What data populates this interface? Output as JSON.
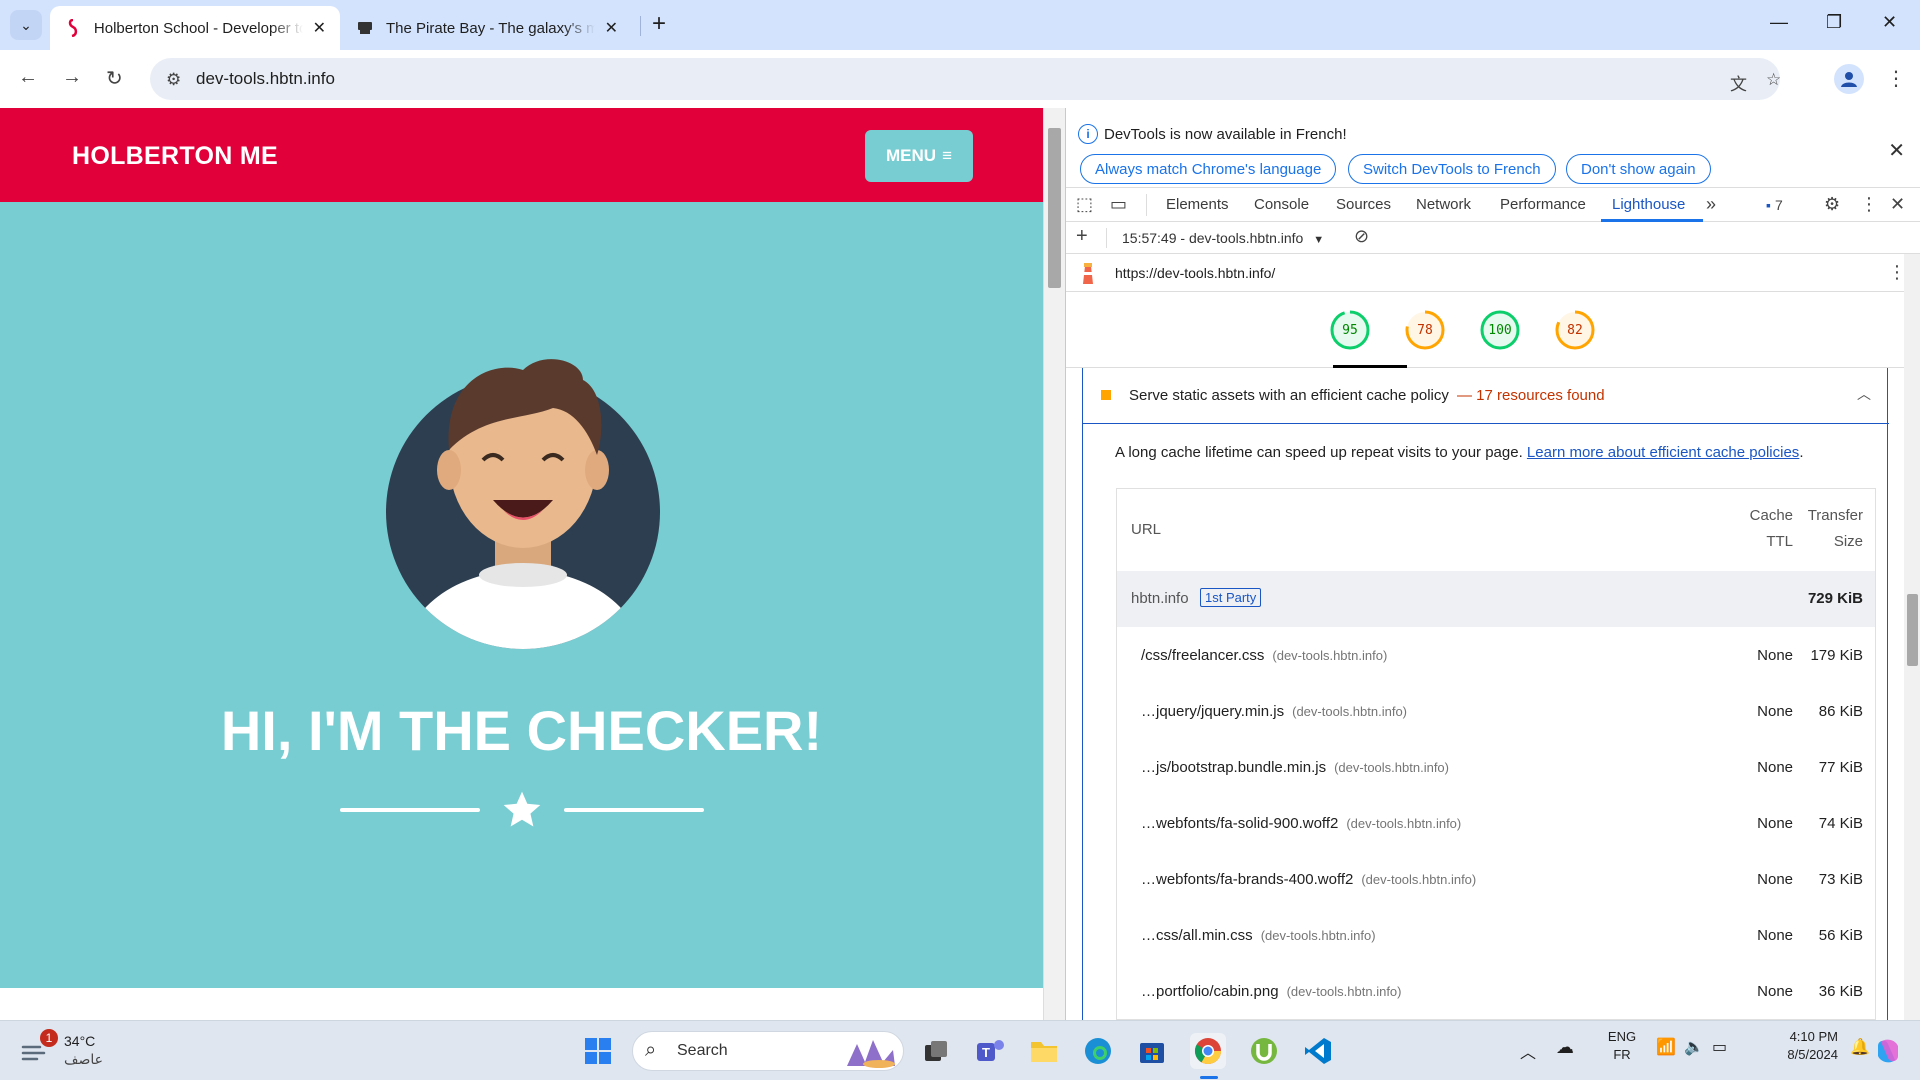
{
  "browser": {
    "tabs": [
      {
        "title": "Holberton School - Developer tools",
        "active": true
      },
      {
        "title": "The Pirate Bay - The galaxy's most resilient BitTorrent site",
        "active": false
      }
    ],
    "url": "dev-tools.hbtn.info"
  },
  "site": {
    "brand": "HOLBERTON ME",
    "menu_label": "MENU",
    "hero_title": "HI, I'M THE CHECKER!"
  },
  "devtools": {
    "infobar": {
      "message": "DevTools is now available in French!",
      "buttons": [
        "Always match Chrome's language",
        "Switch DevTools to French",
        "Don't show again"
      ]
    },
    "tabs": [
      "Elements",
      "Console",
      "Sources",
      "Network",
      "Performance",
      "Lighthouse"
    ],
    "issues_count": "7",
    "report_selector": "15:57:49 - dev-tools.hbtn.info",
    "report_url": "https://dev-tools.hbtn.info/",
    "scores": [
      {
        "value": 95,
        "color": "#0cce6b"
      },
      {
        "value": 78,
        "color": "#ffa400"
      },
      {
        "value": 100,
        "color": "#0cce6b"
      },
      {
        "value": 82,
        "color": "#ffa400"
      }
    ],
    "audit": {
      "title": "Serve static assets with an efficient cache policy",
      "summary": "— 17 resources found",
      "description": "A long cache lifetime can speed up repeat visits to your page.",
      "link_text": "Learn more about efficient cache policies",
      "columns": {
        "url": "URL",
        "cache_line1": "Cache",
        "cache_line2": "TTL",
        "size_line1": "Transfer",
        "size_line2": "Size"
      },
      "group": {
        "name": "hbtn.info",
        "badge": "1st Party",
        "size": "729 KiB"
      },
      "rows": [
        {
          "url": "/css/freelancer.css",
          "host": "(dev-tools.hbtn.info)",
          "ttl": "None",
          "size": "179 KiB"
        },
        {
          "url": "…jquery/jquery.min.js",
          "host": "(dev-tools.hbtn.info)",
          "ttl": "None",
          "size": "86 KiB"
        },
        {
          "url": "…js/bootstrap.bundle.min.js",
          "host": "(dev-tools.hbtn.info)",
          "ttl": "None",
          "size": "77 KiB"
        },
        {
          "url": "…webfonts/fa-solid-900.woff2",
          "host": "(dev-tools.hbtn.info)",
          "ttl": "None",
          "size": "74 KiB"
        },
        {
          "url": "…webfonts/fa-brands-400.woff2",
          "host": "(dev-tools.hbtn.info)",
          "ttl": "None",
          "size": "73 KiB"
        },
        {
          "url": "…css/all.min.css",
          "host": "(dev-tools.hbtn.info)",
          "ttl": "None",
          "size": "56 KiB"
        },
        {
          "url": "…portfolio/cabin.png",
          "host": "(dev-tools.hbtn.info)",
          "ttl": "None",
          "size": "36 KiB"
        }
      ]
    }
  },
  "taskbar": {
    "weather_temp": "34°C",
    "weather_desc": "عاصف",
    "weather_badge": "1",
    "search_label": "Search",
    "lang_top": "ENG",
    "lang_bottom": "FR",
    "time": "4:10 PM",
    "date": "8/5/2024"
  }
}
